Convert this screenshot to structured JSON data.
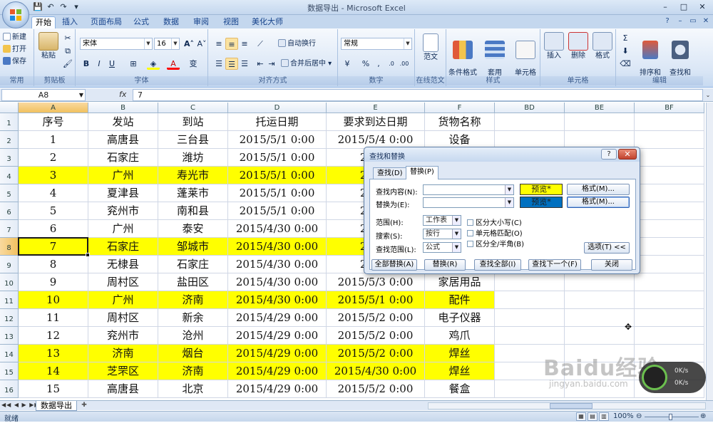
{
  "window": {
    "title": "数据导出 - Microsoft Excel",
    "controls": [
      "–",
      "□",
      "✕"
    ]
  },
  "quick_access": [
    "save-icon",
    "undo-icon",
    "redo-icon",
    "customize-icon"
  ],
  "tabs": [
    {
      "label": "开始",
      "active": true
    },
    {
      "label": "插入"
    },
    {
      "label": "页面布局"
    },
    {
      "label": "公式"
    },
    {
      "label": "数据"
    },
    {
      "label": "审阅"
    },
    {
      "label": "视图"
    },
    {
      "label": "美化大师"
    }
  ],
  "ribbon": {
    "groups": {
      "common": "常用",
      "clipboard": "剪贴板",
      "font": "字体",
      "align": "对齐方式",
      "number": "数字",
      "online": "在线范文",
      "style": "样式",
      "cells": "单元格",
      "edit": "编辑"
    },
    "common_items": [
      "新建",
      "打开",
      "保存"
    ],
    "paste": "粘贴",
    "font_name": "宋体",
    "font_size": "16",
    "wrap_text": "自动换行",
    "merge_center": "合并后居中",
    "number_format": "常规",
    "template": "范文",
    "conditional_format": "条件格式",
    "table_format": "套用\n表格格式",
    "cell_style": "单元格\n样式",
    "insert": "插入",
    "delete": "删除",
    "format": "格式",
    "sort_filter": "排序和\n筛选",
    "find_select": "查找和\n选择"
  },
  "formula_bar": {
    "name_box": "A8",
    "fx": "fx",
    "content": "7"
  },
  "columns": [
    "A",
    "B",
    "C",
    "D",
    "E",
    "F",
    "BD",
    "BE",
    "BF"
  ],
  "selected_column": "A",
  "rows": [
    {
      "n": "1",
      "hl": false,
      "cells": [
        "序号",
        "发站",
        "到站",
        "托运日期",
        "要求到达日期",
        "货物名称"
      ]
    },
    {
      "n": "2",
      "hl": false,
      "cells": [
        "1",
        "高唐县",
        "三台县",
        "2015/5/1  0:00",
        "2015/5/4  0:00",
        "设备"
      ]
    },
    {
      "n": "3",
      "hl": false,
      "cells": [
        "2",
        "石家庄",
        "潍坊",
        "2015/5/1  0:00",
        "2015/",
        ""
      ]
    },
    {
      "n": "4",
      "hl": true,
      "cells": [
        "3",
        "广州",
        "寿光市",
        "2015/5/1  0:00",
        "2015/",
        ""
      ]
    },
    {
      "n": "5",
      "hl": false,
      "cells": [
        "4",
        "夏津县",
        "蓬莱市",
        "2015/5/1  0:00",
        "2015/",
        ""
      ]
    },
    {
      "n": "6",
      "hl": false,
      "cells": [
        "5",
        "兖州市",
        "南和县",
        "2015/5/1  0:00",
        "2015/",
        ""
      ]
    },
    {
      "n": "7",
      "hl": false,
      "cells": [
        "6",
        "广州",
        "泰安",
        "2015/4/30  0:00",
        "2015/",
        ""
      ]
    },
    {
      "n": "8",
      "hl": true,
      "cells": [
        "7",
        "石家庄",
        "邹城市",
        "2015/4/30  0:00",
        "2015/",
        ""
      ]
    },
    {
      "n": "9",
      "hl": false,
      "cells": [
        "8",
        "无棣县",
        "石家庄",
        "2015/4/30  0:00",
        "2015/",
        ""
      ]
    },
    {
      "n": "10",
      "hl": false,
      "cells": [
        "9",
        "周村区",
        "盐田区",
        "2015/4/30  0:00",
        "2015/5/3  0:00",
        "家居用品"
      ]
    },
    {
      "n": "11",
      "hl": true,
      "cells": [
        "10",
        "广州",
        "济南",
        "2015/4/30  0:00",
        "2015/5/1  0:00",
        "配件"
      ]
    },
    {
      "n": "12",
      "hl": false,
      "cells": [
        "11",
        "周村区",
        "新余",
        "2015/4/29  0:00",
        "2015/5/2  0:00",
        "电子仪器"
      ]
    },
    {
      "n": "13",
      "hl": false,
      "cells": [
        "12",
        "兖州市",
        "沧州",
        "2015/4/29  0:00",
        "2015/5/2  0:00",
        "鸡爪"
      ]
    },
    {
      "n": "14",
      "hl": true,
      "cells": [
        "13",
        "济南",
        "烟台",
        "2015/4/29  0:00",
        "2015/5/2  0:00",
        "焊丝"
      ]
    },
    {
      "n": "15",
      "hl": true,
      "cells": [
        "14",
        "芝罘区",
        "济南",
        "2015/4/29  0:00",
        "2015/4/30  0:00",
        "焊丝"
      ]
    },
    {
      "n": "16",
      "hl": false,
      "cells": [
        "15",
        "高唐县",
        "北京",
        "2015/4/29  0:00",
        "2015/5/2  0:00",
        "餐盒"
      ]
    }
  ],
  "active_cell": "A8",
  "sheet_tab": "数据导出",
  "status": {
    "ready": "就绪",
    "zoom": "100%"
  },
  "dialog": {
    "title": "查找和替换",
    "tabs": [
      "查找(D)",
      "替换(P)"
    ],
    "active_tab": "替换(P)",
    "find_label": "查找内容(N):",
    "replace_label": "替换为(E):",
    "find_value": "",
    "replace_value": "",
    "preview1": "预览*",
    "preview2": "预览*",
    "format_btn1": "格式(M)...",
    "format_btn2": "格式(M)...",
    "scope_label": "范围(H):",
    "scope_value": "工作表",
    "search_label": "搜索(S):",
    "search_value": "按行",
    "lookin_label": "查找范围(L):",
    "lookin_value": "公式",
    "chk_case": "区分大小写(C)",
    "chk_cell": "单元格匹配(O)",
    "chk_width": "区分全/半角(B)",
    "options_btn": "选项(T) <<",
    "btn_replace_all": "全部替换(A)",
    "btn_replace": "替换(R)",
    "btn_find_all": "查找全部(I)",
    "btn_find_next": "查找下一个(F)",
    "btn_close": "关闭",
    "help": "?",
    "close_x": "✕"
  },
  "watermark": {
    "main": "Baidu经验",
    "sub": "jingyan.baidu.com"
  },
  "net_widget": {
    "up": "0K/s",
    "down": "0K/s"
  },
  "colors": {
    "highlight": "#ffff00",
    "preview1_bg": "#ffff00",
    "preview2_bg": "#0070c0",
    "ribbon_accent": "#15428b"
  }
}
